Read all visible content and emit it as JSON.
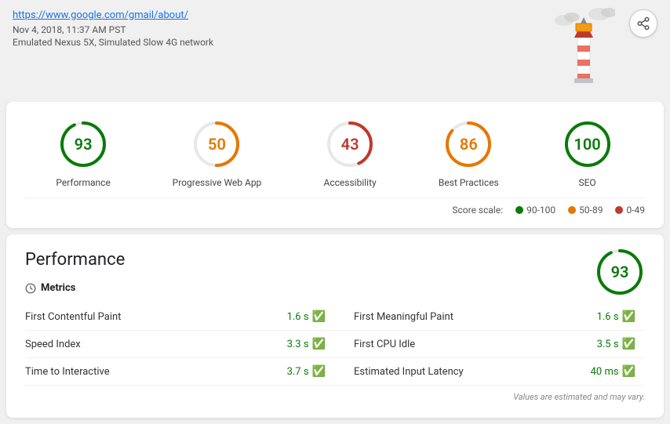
{
  "header": {
    "url": "https://www.google.com/gmail/about/",
    "timestamp": "Nov 4, 2018, 11:37 AM PST",
    "device": "Emulated Nexus 5X, Simulated Slow 4G network",
    "share_label": "Share"
  },
  "scores": [
    {
      "id": "performance",
      "value": 93,
      "label": "Performance",
      "color": "#0a7a0a",
      "percent": 93
    },
    {
      "id": "pwa",
      "value": 50,
      "label": "Progressive Web App",
      "color": "#e67700",
      "percent": 50
    },
    {
      "id": "accessibility",
      "value": 43,
      "label": "Accessibility",
      "color": "#c0392b",
      "percent": 43
    },
    {
      "id": "best-practices",
      "value": 86,
      "label": "Best Practices",
      "color": "#e67700",
      "percent": 86
    },
    {
      "id": "seo",
      "value": 100,
      "label": "SEO",
      "color": "#0a7a0a",
      "percent": 100
    }
  ],
  "score_scale": {
    "label": "Score scale:",
    "ranges": [
      {
        "range": "90-100",
        "color": "#0a7a0a"
      },
      {
        "range": "50-89",
        "color": "#e67700"
      },
      {
        "range": "0-49",
        "color": "#c0392b"
      }
    ]
  },
  "performance": {
    "title": "Performance",
    "score": 93,
    "metrics_label": "Metrics",
    "metrics": [
      {
        "name": "First Contentful Paint",
        "value": "1.6 s",
        "status": "pass"
      },
      {
        "name": "First Meaningful Paint",
        "value": "1.6 s",
        "status": "pass"
      },
      {
        "name": "Speed Index",
        "value": "3.3 s",
        "status": "pass"
      },
      {
        "name": "First CPU Idle",
        "value": "3.5 s",
        "status": "pass"
      },
      {
        "name": "Time to Interactive",
        "value": "3.7 s",
        "status": "pass"
      },
      {
        "name": "Estimated Input Latency",
        "value": "40 ms",
        "status": "pass"
      }
    ],
    "note": "Values are estimated and may vary."
  }
}
